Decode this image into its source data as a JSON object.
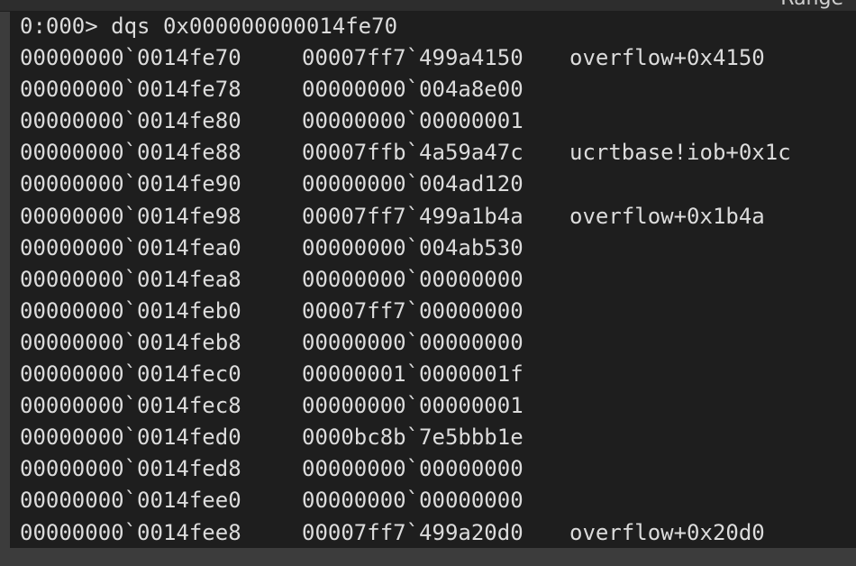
{
  "header": {
    "range_label": "Range"
  },
  "console": {
    "command_line": "0:000> dqs 0x000000000014fe70",
    "rows": [
      {
        "address": "00000000`0014fe70",
        "value": "00007ff7`499a4150",
        "symbol": "overflow+0x4150"
      },
      {
        "address": "00000000`0014fe78",
        "value": "00000000`004a8e00",
        "symbol": ""
      },
      {
        "address": "00000000`0014fe80",
        "value": "00000000`00000001",
        "symbol": ""
      },
      {
        "address": "00000000`0014fe88",
        "value": "00007ffb`4a59a47c",
        "symbol": "ucrtbase!iob+0x1c"
      },
      {
        "address": "00000000`0014fe90",
        "value": "00000000`004ad120",
        "symbol": ""
      },
      {
        "address": "00000000`0014fe98",
        "value": "00007ff7`499a1b4a",
        "symbol": "overflow+0x1b4a"
      },
      {
        "address": "00000000`0014fea0",
        "value": "00000000`004ab530",
        "symbol": ""
      },
      {
        "address": "00000000`0014fea8",
        "value": "00000000`00000000",
        "symbol": ""
      },
      {
        "address": "00000000`0014feb0",
        "value": "00007ff7`00000000",
        "symbol": ""
      },
      {
        "address": "00000000`0014feb8",
        "value": "00000000`00000000",
        "symbol": ""
      },
      {
        "address": "00000000`0014fec0",
        "value": "00000001`0000001f",
        "symbol": ""
      },
      {
        "address": "00000000`0014fec8",
        "value": "00000000`00000001",
        "symbol": ""
      },
      {
        "address": "00000000`0014fed0",
        "value": "0000bc8b`7e5bbb1e",
        "symbol": ""
      },
      {
        "address": "00000000`0014fed8",
        "value": "00000000`00000000",
        "symbol": ""
      },
      {
        "address": "00000000`0014fee0",
        "value": "00000000`00000000",
        "symbol": ""
      },
      {
        "address": "00000000`0014fee8",
        "value": "00007ff7`499a20d0",
        "symbol": "overflow+0x20d0"
      }
    ]
  }
}
